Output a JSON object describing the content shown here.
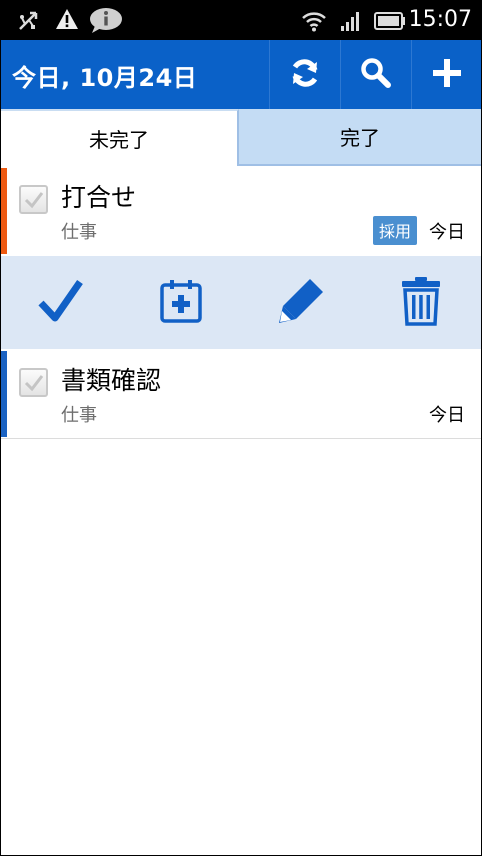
{
  "status_bar": {
    "time": "15:07",
    "icons": [
      "usb-icon",
      "warning-icon",
      "info-chat-icon",
      "wifi-icon",
      "signal-icon",
      "battery-icon"
    ]
  },
  "action_bar": {
    "title": "今日, 10月24日",
    "buttons": [
      "sync-icon",
      "search-icon",
      "add-icon"
    ],
    "color": "#0a61c8"
  },
  "tabs": [
    {
      "label": "未完了",
      "selected": true
    },
    {
      "label": "完了",
      "selected": false
    }
  ],
  "tasks": [
    {
      "title": "打合せ",
      "category": "仕事",
      "tag": "採用",
      "date": "今日",
      "priority_color": "#ee5a12",
      "checked": false
    },
    {
      "title": "書類確認",
      "category": "仕事",
      "date": "今日",
      "priority_color": "#1a62c2",
      "checked": false
    }
  ],
  "task_toolbar": {
    "buttons": [
      "complete-checkmark-icon",
      "calendar-add-icon",
      "edit-pencil-icon",
      "delete-trash-icon"
    ],
    "icon_color": "#1160c6"
  }
}
